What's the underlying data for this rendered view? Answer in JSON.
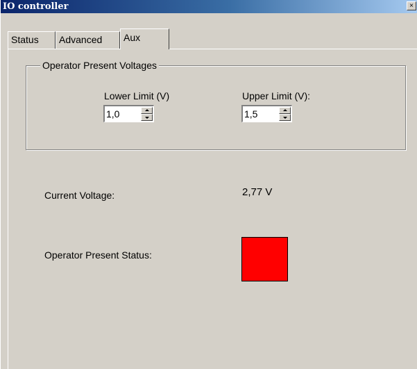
{
  "window": {
    "title": "IO controller",
    "close_glyph": "×"
  },
  "tabs": [
    {
      "label": "Status",
      "active": false
    },
    {
      "label": "Advanced",
      "active": false
    },
    {
      "label": "Aux",
      "active": true
    }
  ],
  "aux": {
    "group_title": "Operator Present Voltages",
    "lower_limit": {
      "label": "Lower Limit (V)",
      "value": "1,0"
    },
    "upper_limit": {
      "label": "Upper Limit  (V):",
      "value": "1,5"
    },
    "current_voltage": {
      "label": "Current Voltage:",
      "value": "2,77 V"
    },
    "operator_status": {
      "label": "Operator Present Status:",
      "indicator_color": "#ff0000"
    }
  },
  "colors": {
    "dialog_face": "#d4d0c8",
    "titlebar_start": "#0a246a",
    "titlebar_end": "#a6caf0",
    "status_red": "#ff0000"
  }
}
